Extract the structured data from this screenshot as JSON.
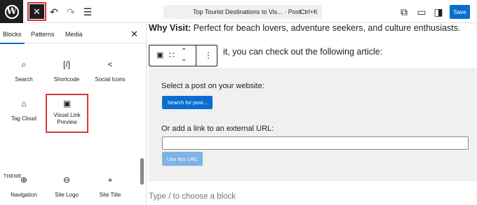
{
  "topbar": {
    "command_title": "Top Tourist Destinations to Vis... · Post",
    "command_shortcut": "Ctrl+K",
    "save_label": "Save",
    "close_glyph": "✕",
    "undo_glyph": "↶",
    "redo_glyph": "↷",
    "outline_glyph": "☰",
    "view_glyph": "⧉",
    "preview_glyph": "▭",
    "settings_glyph": "◨",
    "more_glyph": "⋮",
    "logo_letter": "W"
  },
  "sidebar": {
    "tabs": [
      "Blocks",
      "Patterns",
      "Media"
    ],
    "close_glyph": "✕",
    "blocks": [
      {
        "label": "Search",
        "icon": "⌕"
      },
      {
        "label": "Shortcode",
        "icon": "[/]"
      },
      {
        "label": "Social Icons",
        "icon": "<"
      },
      {
        "label": "Tag Cloud",
        "icon": "⌂"
      },
      {
        "label": "Visual Link Preview",
        "icon": "▣"
      }
    ],
    "theme_heading": "THEME",
    "theme_blocks": [
      {
        "label": "Navigation",
        "icon": "⊕"
      },
      {
        "label": "Site Logo",
        "icon": "⊖"
      },
      {
        "label": "Site Title",
        "icon": "⌖"
      }
    ]
  },
  "content": {
    "why_label": "Why Visit:",
    "why_text": " Perfect for beach lovers, adventure seekers, and culture enthusiasts.",
    "line2": "it, you can check out the following article:",
    "toolbar_icons": [
      "▣",
      "∷",
      "⌃⌄",
      "⋮"
    ],
    "panel": {
      "select_label": "Select a post on your website:",
      "search_button": "Search for post...",
      "external_label": "Or add a link to an external URL:",
      "url_value": "",
      "use_button": "Use this URL"
    },
    "placeholder": "Type / to choose a block"
  }
}
